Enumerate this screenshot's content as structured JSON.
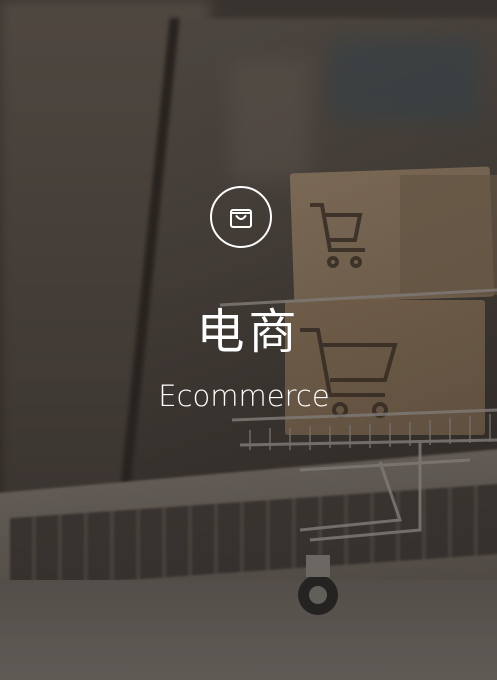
{
  "card": {
    "icon": "shopping-bag-icon",
    "title_cn": "电商",
    "title_en": "Ecommerce"
  },
  "colors": {
    "text": "#ffffff",
    "overlay": "#1c1814",
    "box": "#a18769"
  }
}
